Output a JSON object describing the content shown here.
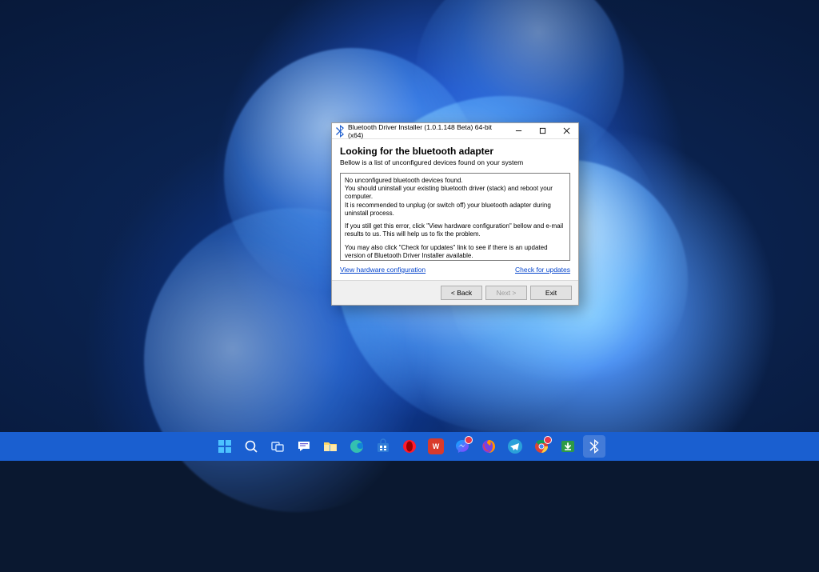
{
  "dialog": {
    "title": "Bluetooth Driver Installer (1.0.1.148 Beta) 64-bit (x64)",
    "heading": "Looking for the bluetooth adapter",
    "subheading": "Bellow is a list of unconfigured devices found on your system",
    "message_p1": "No unconfigured bluetooth devices found.\nYou should uninstall your existing bluetooth driver (stack) and reboot your computer.\nIt is recommended to unplug (or switch off) your bluetooth adapter during uninstall process.",
    "message_p2": "If you still get this error, click \"View hardware configuration\" bellow and e-mail results to us. This will help us to fix the problem.",
    "message_p3": "You may also click \"Check for updates\" link to see if there is an updated version of Bluetooth Driver Installer available.",
    "link_left": "View hardware configuration",
    "link_right": "Check for updates",
    "btn_back": "< Back",
    "btn_next": "Next >",
    "btn_exit": "Exit"
  },
  "taskbar": {
    "icons": [
      "start",
      "search",
      "task-view",
      "chat",
      "file-explorer",
      "edge",
      "store",
      "opera",
      "wps",
      "messenger",
      "firefox",
      "telegram",
      "chrome",
      "idm",
      "bluetooth-installer"
    ]
  }
}
